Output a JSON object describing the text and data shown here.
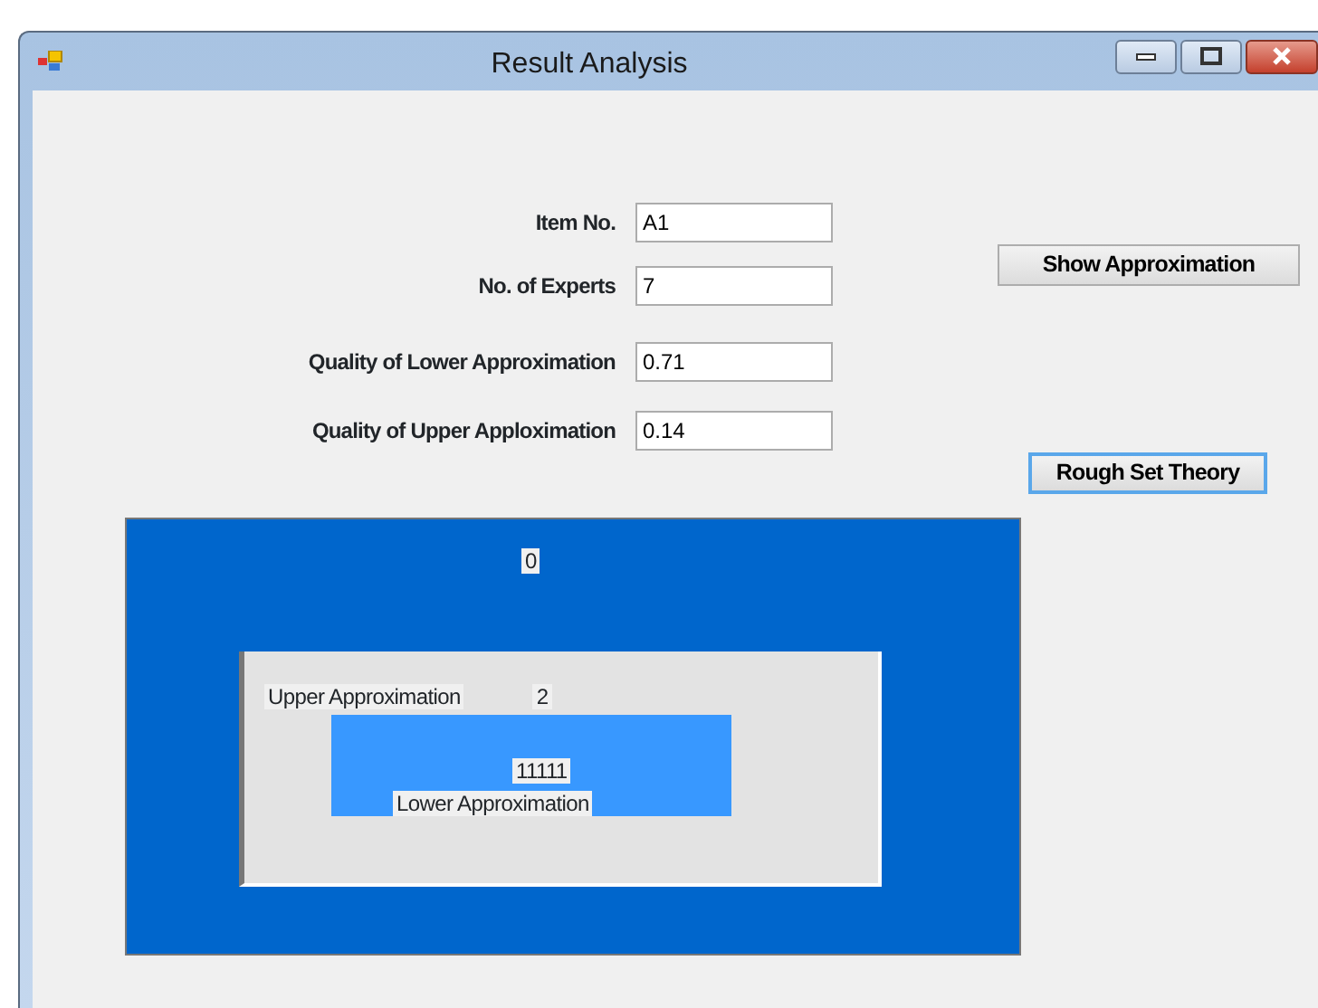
{
  "window": {
    "title": "Result Analysis"
  },
  "fields": [
    {
      "label": "Item No.",
      "value": "A1"
    },
    {
      "label": "No. of Experts",
      "value": "7"
    },
    {
      "label": "Quality of Lower Approximation",
      "value": "0.71"
    },
    {
      "label": "Quality of Upper Apploximation",
      "value": "0.14"
    }
  ],
  "buttons": [
    {
      "label": "Show Approximation",
      "focused": false
    },
    {
      "label": "Rough Set Theory",
      "focused": true
    }
  ],
  "diagram": {
    "outer_value": "0",
    "upper_label": "Upper Approximation",
    "upper_value": "2",
    "lower_value": "11111",
    "lower_label": "Lower Approximation"
  }
}
